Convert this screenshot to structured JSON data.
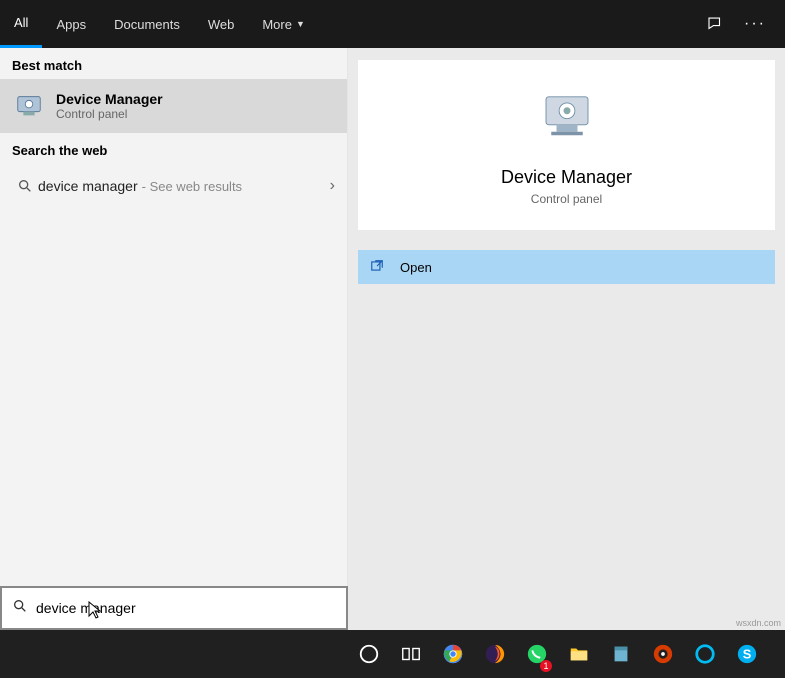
{
  "tabs": {
    "all": "All",
    "apps": "Apps",
    "documents": "Documents",
    "web": "Web",
    "more": "More"
  },
  "left": {
    "best_match": "Best match",
    "result_title": "Device Manager",
    "result_sub": "Control panel",
    "search_web": "Search the web",
    "web_term": "device manager",
    "web_hint": "- See web results"
  },
  "preview": {
    "title": "Device Manager",
    "sub": "Control panel",
    "open": "Open"
  },
  "search": {
    "value": "device manager"
  },
  "taskbar": {
    "whatsapp_badge": "1"
  },
  "watermark": "wsxdn.com"
}
